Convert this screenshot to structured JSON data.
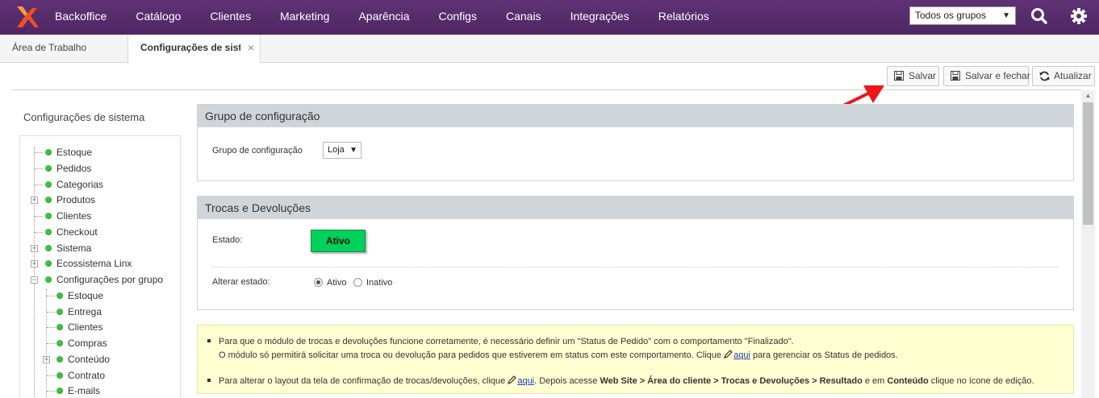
{
  "nav": {
    "items": [
      "Backoffice",
      "Catálogo",
      "Clientes",
      "Marketing",
      "Aparência",
      "Configs",
      "Canais",
      "Integrações",
      "Relatórios"
    ],
    "group_select": "Todos os grupos",
    "brand_color": "#5a2d6e"
  },
  "tabs": {
    "desktop": "Área de Trabalho",
    "active": "Configurações de sistema",
    "close": "×"
  },
  "toolbar": {
    "save": "Salvar",
    "save_close": "Salvar e fechar",
    "refresh": "Atualizar"
  },
  "sidebar": {
    "title": "Configurações de sistema",
    "items": [
      "Estoque",
      "Pedidos",
      "Categorias",
      "Produtos",
      "Clientes",
      "Checkout",
      "Sistema",
      "Ecossistema Linx",
      "Configurações por grupo"
    ],
    "children": [
      "Estoque",
      "Entrega",
      "Clientes",
      "Compras",
      "Conteúdo",
      "Contrato",
      "E-mails"
    ]
  },
  "group_panel": {
    "title": "Grupo de configuração",
    "label": "Grupo de configuração",
    "value": "Loja"
  },
  "returns_panel": {
    "title": "Trocas e Devoluções",
    "state_label": "Estado:",
    "state_value": "Ativo",
    "state_color": "#00d15a",
    "change_label": "Alterar estado:",
    "option_active": "Ativo",
    "option_inactive": "Inativo",
    "selected": "Ativo"
  },
  "info": {
    "line1": "Para que o módulo de trocas e devoluções funcione corretamente, é necessário definir um \"Status de Pedido\" com o comportamento \"Finalizado\".",
    "line2_pre": "O módulo só permitirá solicitar uma troca ou devolução para pedidos que estiverem em status com este comportamento. Clique",
    "line2_link": "aqui",
    "line2_post": "para gerenciar os Status de pedidos.",
    "line3_pre": "Para alterar o layout da tela de confirmação de trocas/devoluções, clique",
    "line3_link": "aqui",
    "line3_mid": ". Depois acesse",
    "line3_path": "Web Site > Área do cliente > Trocas e Devoluções > Resultado",
    "line3_and": "e em",
    "line3_content": "Conteúdo",
    "line3_post": "clique no ícone de edição."
  }
}
